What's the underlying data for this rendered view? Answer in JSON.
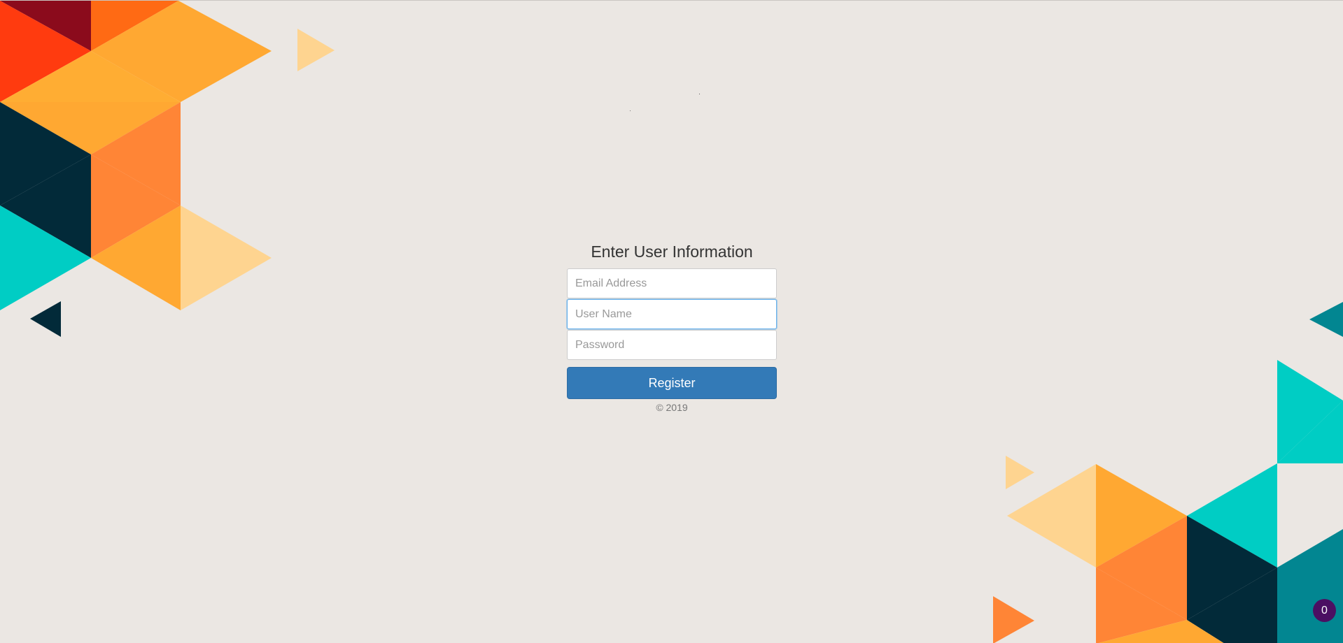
{
  "form": {
    "title": "Enter User Information",
    "email_placeholder": "Email Address",
    "username_placeholder": "User Name",
    "password_placeholder": "Password",
    "register_label": "Register",
    "copyright": "© 2019"
  },
  "badge": {
    "count": "0"
  },
  "colors": {
    "background": "#ebe7e3",
    "button": "#337ab7",
    "badge": "#4b0f62",
    "accent_orange": "#ffa832",
    "accent_teal": "#00cdc4",
    "accent_navy": "#022a39"
  }
}
